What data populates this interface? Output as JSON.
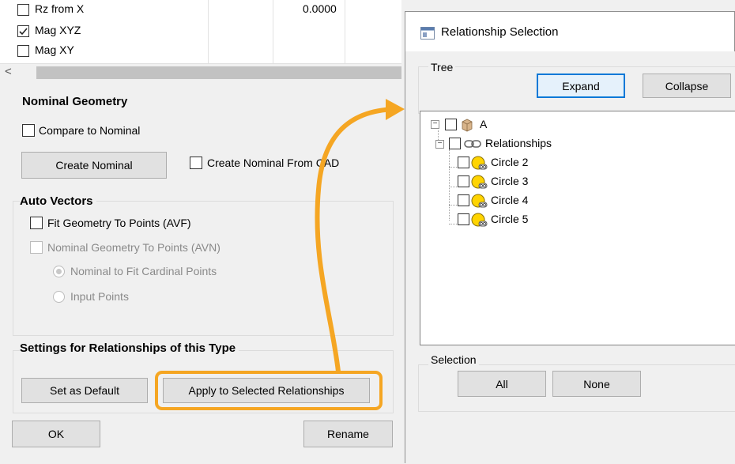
{
  "list": {
    "rows": [
      {
        "label": "Rz from X",
        "value": "0.0000",
        "checked": false
      },
      {
        "label": "Mag XYZ",
        "value": "",
        "checked": true
      },
      {
        "label": "Mag XY",
        "value": "",
        "checked": false
      }
    ],
    "scroll_left_glyph": "<"
  },
  "nominal_geometry": {
    "title": "Nominal Geometry",
    "compare_label": "Compare to Nominal",
    "create_button": "Create Nominal",
    "from_cad_label": "Create Nominal From CAD"
  },
  "auto_vectors": {
    "title": "Auto Vectors",
    "fit_label": "Fit Geometry To Points (AVF)",
    "nominal_label": "Nominal Geometry To Points (AVN)",
    "radio_fit_cardinal": "Nominal to Fit Cardinal Points",
    "radio_input_points": "Input Points"
  },
  "settings": {
    "title": "Settings for Relationships of this Type",
    "default_button": "Set as Default",
    "apply_button": "Apply to Selected Relationships"
  },
  "footer": {
    "ok_button": "OK",
    "rename_button": "Rename"
  },
  "relationship_dialog": {
    "title": "Relationship Selection",
    "tree_group": "Tree",
    "expand_button": "Expand",
    "collapse_button": "Collapse",
    "selection_group": "Selection",
    "all_button": "All",
    "none_button": "None",
    "tree": {
      "root": "A",
      "folder": "Relationships",
      "items": [
        "Circle 2",
        "Circle 3",
        "Circle 4",
        "Circle 5"
      ]
    }
  },
  "colors": {
    "highlight": "#f5a623",
    "expand_border": "#0078d7",
    "circle_fill": "#ffd400"
  }
}
